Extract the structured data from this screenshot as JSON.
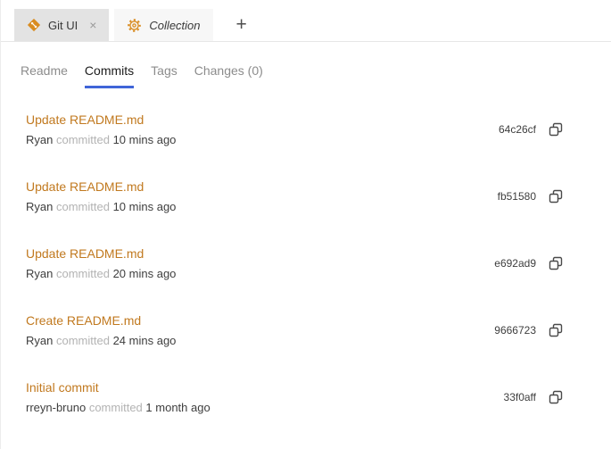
{
  "colors": {
    "link_orange": "#c1791f",
    "icon_orange": "#d98c21",
    "active_tab_underline": "#4065d8"
  },
  "tab_bar": {
    "tabs": [
      {
        "label": "Git UI",
        "icon": "git-icon",
        "close_glyph": "×",
        "active": true
      },
      {
        "label": "Collection",
        "icon": "gear-icon",
        "active": false
      }
    ],
    "new_tab_glyph": "+"
  },
  "section_tabs": [
    {
      "label": "Readme",
      "active": false
    },
    {
      "label": "Commits",
      "active": true
    },
    {
      "label": "Tags",
      "active": false
    },
    {
      "label": "Changes (0)",
      "active": false
    }
  ],
  "commits": [
    {
      "message": "Update README.md",
      "author": "Ryan",
      "action": "committed",
      "time": "10 mins ago",
      "hash": "64c26cf"
    },
    {
      "message": "Update README.md",
      "author": "Ryan",
      "action": "committed",
      "time": "10 mins ago",
      "hash": "fb51580"
    },
    {
      "message": "Update README.md",
      "author": "Ryan",
      "action": "committed",
      "time": "20 mins ago",
      "hash": "e692ad9"
    },
    {
      "message": "Create README.md",
      "author": "Ryan",
      "action": "committed",
      "time": "24 mins ago",
      "hash": "9666723"
    },
    {
      "message": "Initial commit",
      "author": "rreyn-bruno",
      "action": "committed",
      "time": "1 month ago",
      "hash": "33f0aff"
    }
  ]
}
